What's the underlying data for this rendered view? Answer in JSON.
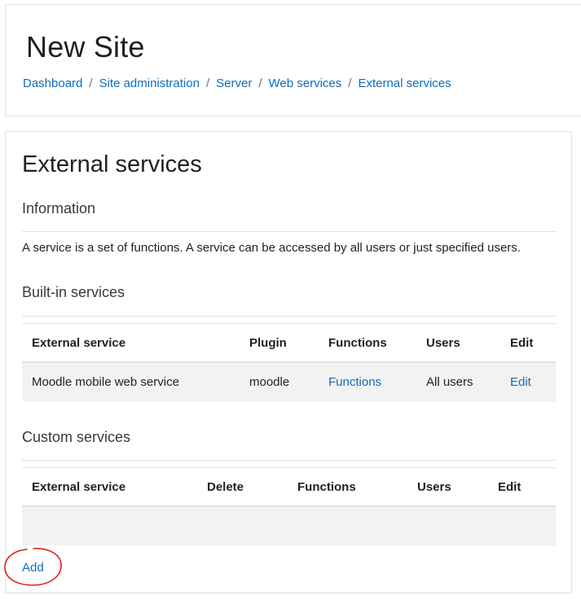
{
  "header": {
    "site_title": "New Site",
    "breadcrumb": [
      {
        "label": "Dashboard"
      },
      {
        "label": "Site administration"
      },
      {
        "label": "Server"
      },
      {
        "label": "Web services"
      },
      {
        "label": "External services"
      }
    ],
    "separator": "/"
  },
  "main": {
    "heading": "External services",
    "information_heading": "Information",
    "information_text": "A service is a set of functions. A service can be accessed by all users or just specified users.",
    "builtin": {
      "heading": "Built-in services",
      "columns": [
        "External service",
        "Plugin",
        "Functions",
        "Users",
        "Edit"
      ],
      "rows": [
        {
          "service": "Moodle mobile web service",
          "plugin": "moodle",
          "functions": "Functions",
          "users": "All users",
          "edit": "Edit"
        }
      ]
    },
    "custom": {
      "heading": "Custom services",
      "columns": [
        "External service",
        "Delete",
        "Functions",
        "Users",
        "Edit"
      ],
      "rows": []
    },
    "add_label": "Add"
  },
  "colors": {
    "link": "#0f6cbf",
    "text": "#1d2125",
    "row_background": "#f2f2f2",
    "border": "#dee2e6",
    "annotation": "#e0201c"
  }
}
